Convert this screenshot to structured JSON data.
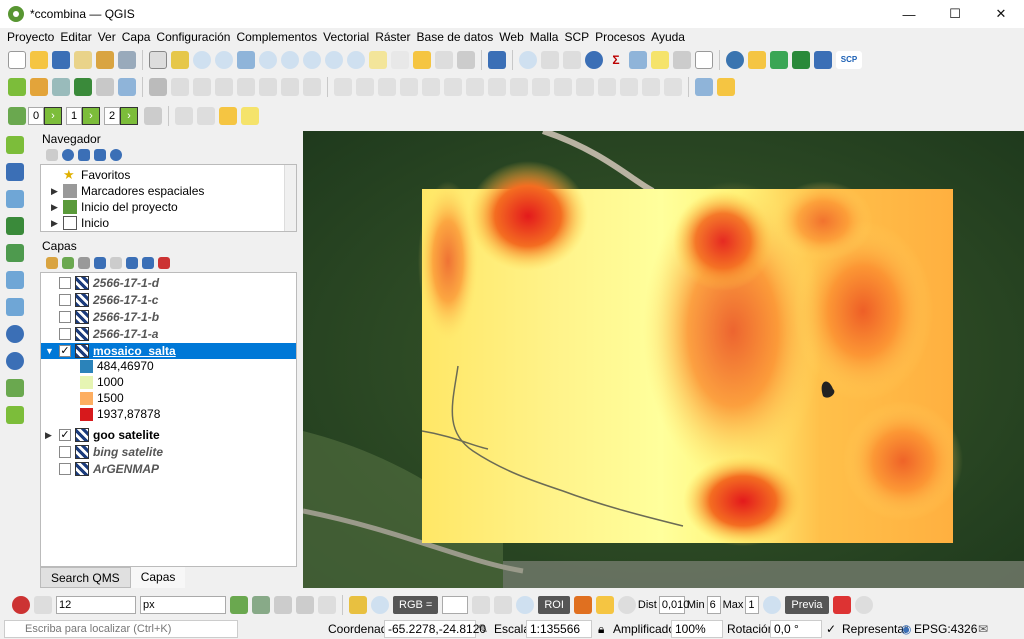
{
  "window": {
    "title": "*ccombina — QGIS",
    "minimize": "—",
    "maximize": "☐",
    "close": "✕"
  },
  "menu": [
    "Proyecto",
    "Editar",
    "Ver",
    "Capa",
    "Configuración",
    "Complementos",
    "Vectorial",
    "Ráster",
    "Base de datos",
    "Web",
    "Malla",
    "SCP",
    "Procesos",
    "Ayuda"
  ],
  "toolbar3": {
    "spin1": "0",
    "spin2": "1",
    "spin3": "2"
  },
  "navigator": {
    "title": "Navegador",
    "items": [
      "Favoritos",
      "Marcadores espaciales",
      "Inicio del proyecto",
      "Inicio"
    ]
  },
  "layers": {
    "title": "Capas",
    "rows": [
      {
        "name": "2566-17-1-d",
        "checked": false
      },
      {
        "name": "2566-17-1-c",
        "checked": false
      },
      {
        "name": "2566-17-1-b",
        "checked": false
      },
      {
        "name": "2566-17-1-a",
        "checked": false
      },
      {
        "name": "mosaico_salta",
        "checked": true
      },
      {
        "name": "goo satelite",
        "checked": true
      },
      {
        "name": "bing satelite",
        "checked": false
      },
      {
        "name": "ArGENMAP",
        "checked": false
      }
    ],
    "legend": [
      {
        "label": "484,46970",
        "color": "#2b83ba"
      },
      {
        "label": "1000",
        "color": "#e6f5b3"
      },
      {
        "label": "1500",
        "color": "#fdae61"
      },
      {
        "label": "1937,87878",
        "color": "#d7191c"
      }
    ]
  },
  "tabs": [
    "Search QMS",
    "Capas"
  ],
  "bottom_toolbar": {
    "size": "12",
    "unit": "px",
    "rgb": "RGB =",
    "roi": "ROI",
    "dist": "Dist",
    "dist_val": "0,010",
    "min": "Min",
    "min_val": "6",
    "max": "Max",
    "max_val": "1",
    "preview": "Previa"
  },
  "status": {
    "search_placeholder": "Escriba para localizar (Ctrl+K)",
    "coord_label": "Coordenada",
    "coord_value": "-65.2278,-24.8120",
    "scale_label": "Escala",
    "scale_value": "1:135566",
    "magnifier_label": "Amplificador",
    "magnifier_value": "100%",
    "rotation_label": "Rotación",
    "rotation_value": "0,0 °",
    "render_label": "Representar",
    "crs": "EPSG:4326"
  },
  "colors": {
    "selection": "#0078d7",
    "dem_low": "#ffff8a",
    "dem_high": "#e31a1c"
  }
}
